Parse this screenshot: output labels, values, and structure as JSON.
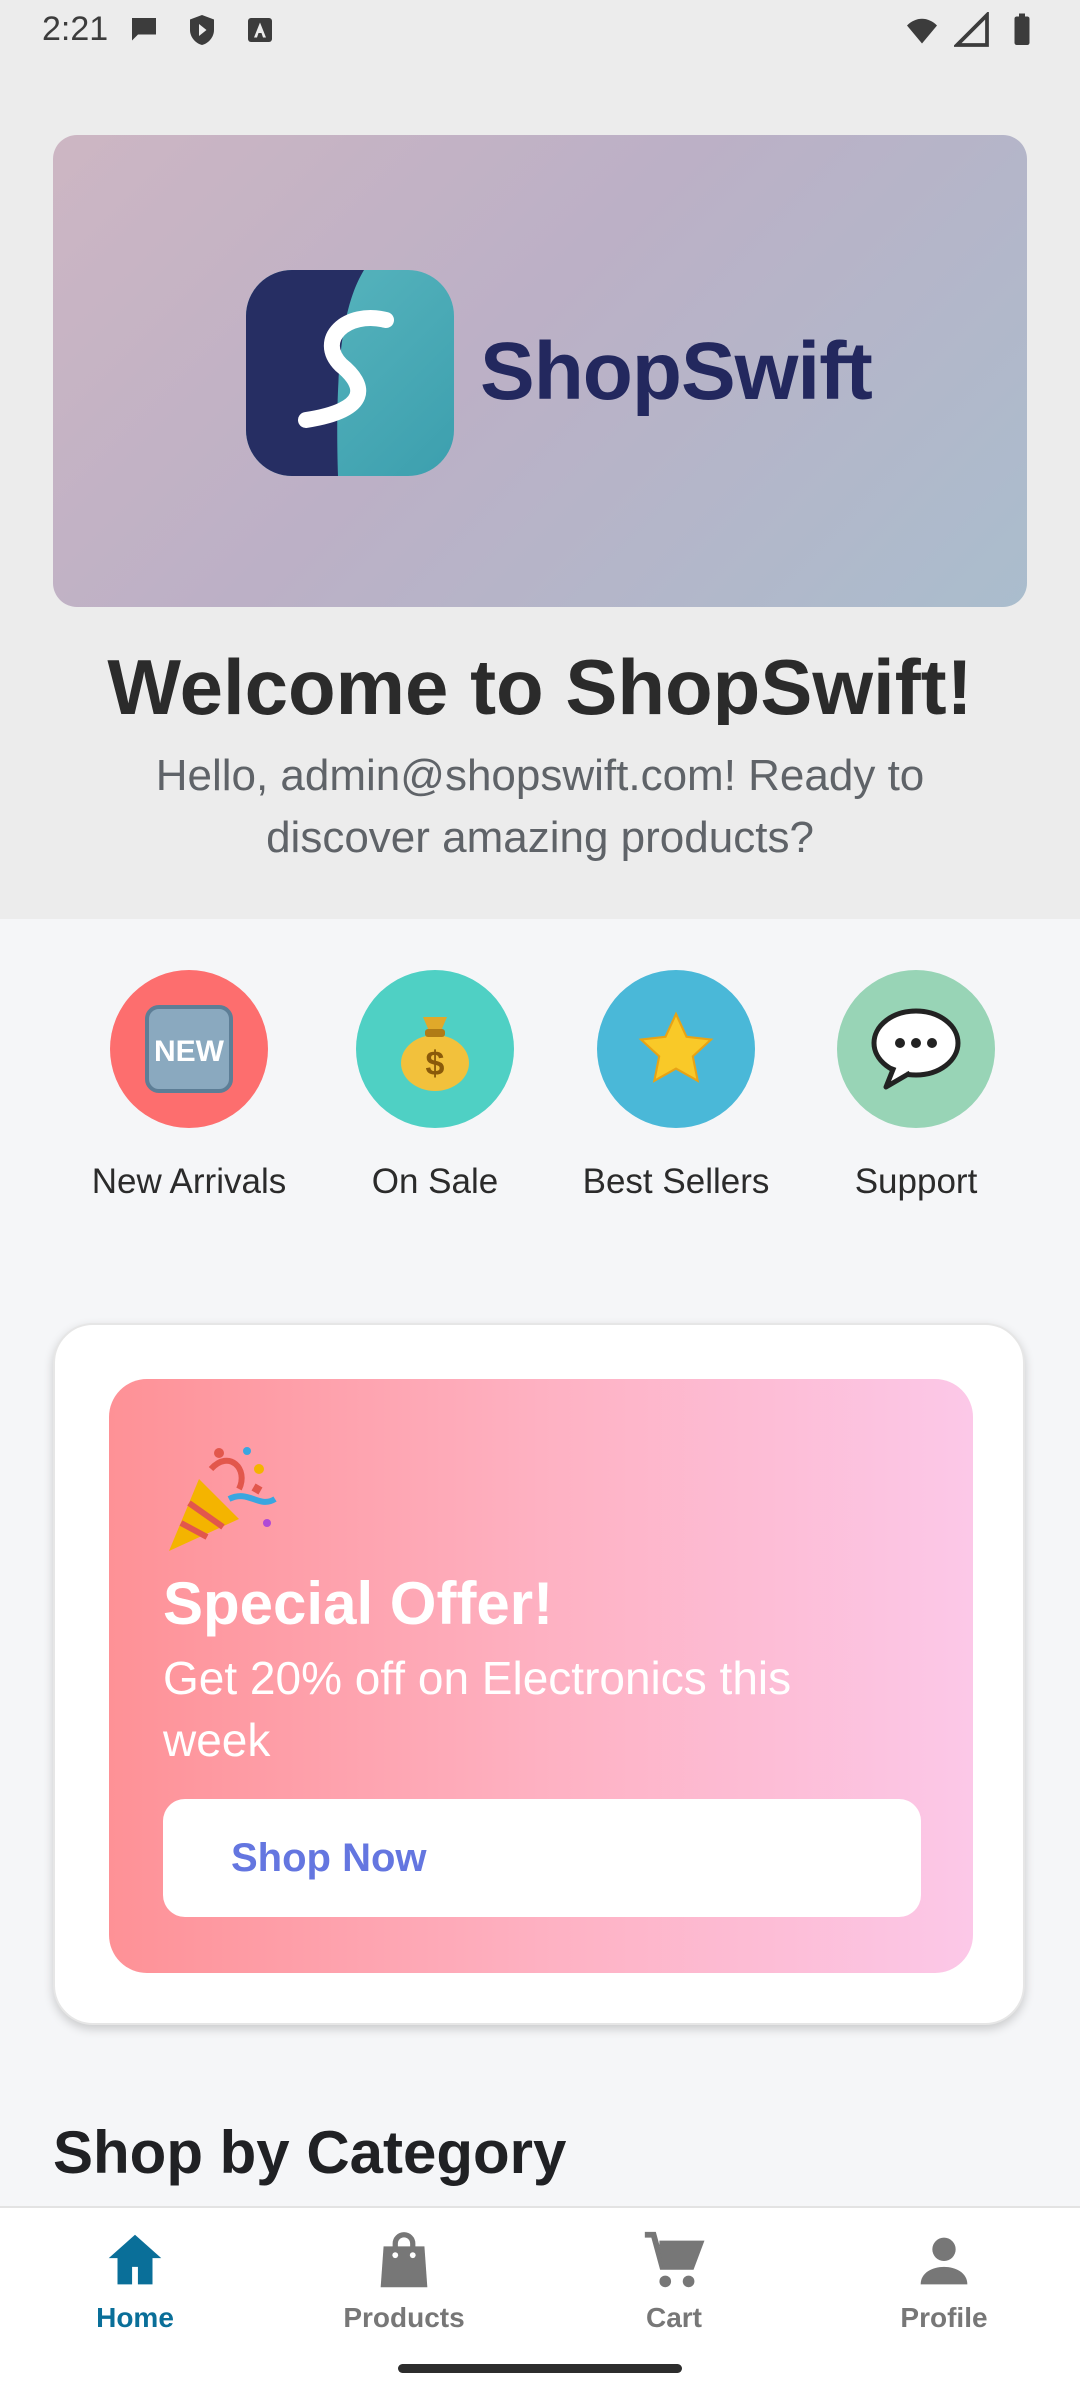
{
  "status_bar": {
    "time": "2:21"
  },
  "hero": {
    "logo_text": "ShopSwift"
  },
  "welcome": {
    "title": "Welcome to ShopSwift!",
    "subtitle": "Hello, admin@shopswift.com! Ready to discover amazing products?"
  },
  "quick_actions": [
    {
      "label": "New Arrivals",
      "icon": "new-icon",
      "color": "#fd6e6e"
    },
    {
      "label": "On Sale",
      "icon": "money-bag-icon",
      "color": "#4fd0c4"
    },
    {
      "label": "Best Sellers",
      "icon": "star-icon",
      "color": "#4ab8d8"
    },
    {
      "label": "Support",
      "icon": "speech-bubble-icon",
      "color": "#98d4b6"
    }
  ],
  "promo": {
    "title": "Special Offer!",
    "text": "Get 20% off on Electronics this week",
    "button_label": "Shop Now"
  },
  "section": {
    "title": "Shop by Category"
  },
  "bottom_nav": {
    "items": [
      {
        "label": "Home",
        "icon": "home-icon",
        "active": true
      },
      {
        "label": "Products",
        "icon": "shopping-bag-icon",
        "active": false
      },
      {
        "label": "Cart",
        "icon": "cart-icon",
        "active": false
      },
      {
        "label": "Profile",
        "icon": "person-icon",
        "active": false
      }
    ]
  },
  "colors": {
    "accent": "#0a6f99",
    "brand_navy": "#23285e",
    "promo_button_text": "#6476e0"
  }
}
